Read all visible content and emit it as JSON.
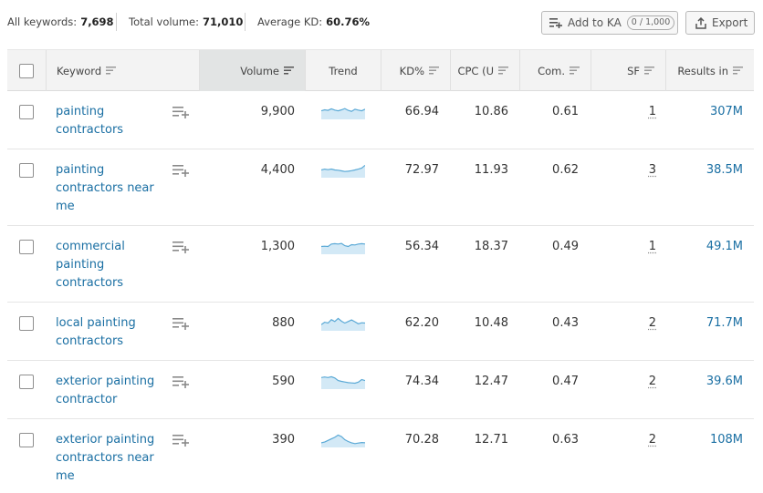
{
  "summary": {
    "all_keywords_label": "All keywords:",
    "all_keywords_value": "7,698",
    "total_volume_label": "Total volume:",
    "total_volume_value": "71,010",
    "average_kd_label": "Average KD:",
    "average_kd_value": "60.76%"
  },
  "actions": {
    "add_to_ka_label": "Add to KA",
    "ka_counter": "0 / 1,000",
    "export_label": "Export"
  },
  "columns": {
    "keyword": "Keyword",
    "volume": "Volume",
    "trend": "Trend",
    "kd": "KD%",
    "cpc": "CPC (U",
    "com": "Com.",
    "sf": "SF",
    "results": "Results in"
  },
  "sorted_column": "volume",
  "colors": {
    "link": "#1a6fa3",
    "trend_line": "#5aa9d6",
    "trend_fill": "#d3e9f6",
    "header_bg": "#f3f3f3",
    "sorted_header_bg": "#e2e4e4"
  },
  "rows": [
    {
      "keyword": "painting contractors",
      "volume": "9,900",
      "kd": "66.94",
      "cpc": "10.86",
      "com": "0.61",
      "sf": "1",
      "results": "307M",
      "trend": [
        0.55,
        0.62,
        0.58,
        0.68,
        0.6,
        0.55,
        0.62,
        0.7,
        0.58,
        0.52,
        0.65,
        0.6,
        0.55,
        0.66
      ]
    },
    {
      "keyword": "painting contractors near me",
      "volume": "4,400",
      "kd": "72.97",
      "cpc": "11.93",
      "com": "0.62",
      "sf": "3",
      "results": "38.5M",
      "trend": [
        0.5,
        0.55,
        0.52,
        0.56,
        0.5,
        0.48,
        0.44,
        0.4,
        0.42,
        0.45,
        0.5,
        0.55,
        0.62,
        0.8
      ]
    },
    {
      "keyword": "commercial painting contractors",
      "volume": "1,300",
      "kd": "56.34",
      "cpc": "18.37",
      "com": "0.49",
      "sf": "1",
      "results": "49.1M",
      "trend": [
        0.5,
        0.52,
        0.5,
        0.66,
        0.68,
        0.66,
        0.7,
        0.55,
        0.5,
        0.62,
        0.6,
        0.66,
        0.68,
        0.66
      ]
    },
    {
      "keyword": "local painting contractors",
      "volume": "880",
      "kd": "62.20",
      "cpc": "10.48",
      "com": "0.43",
      "sf": "2",
      "results": "71.7M",
      "trend": [
        0.4,
        0.55,
        0.5,
        0.72,
        0.6,
        0.8,
        0.62,
        0.5,
        0.6,
        0.7,
        0.58,
        0.45,
        0.52,
        0.5
      ]
    },
    {
      "keyword": "exterior painting contractor",
      "volume": "590",
      "kd": "74.34",
      "cpc": "12.47",
      "com": "0.47",
      "sf": "2",
      "results": "39.6M",
      "trend": [
        0.75,
        0.78,
        0.75,
        0.8,
        0.72,
        0.55,
        0.5,
        0.46,
        0.42,
        0.4,
        0.38,
        0.45,
        0.62,
        0.55
      ]
    },
    {
      "keyword": "exterior painting contractors near me",
      "volume": "390",
      "kd": "70.28",
      "cpc": "12.71",
      "com": "0.63",
      "sf": "2",
      "results": "108M",
      "trend": [
        0.3,
        0.35,
        0.45,
        0.55,
        0.65,
        0.8,
        0.7,
        0.5,
        0.38,
        0.3,
        0.25,
        0.28,
        0.32,
        0.3
      ]
    }
  ]
}
